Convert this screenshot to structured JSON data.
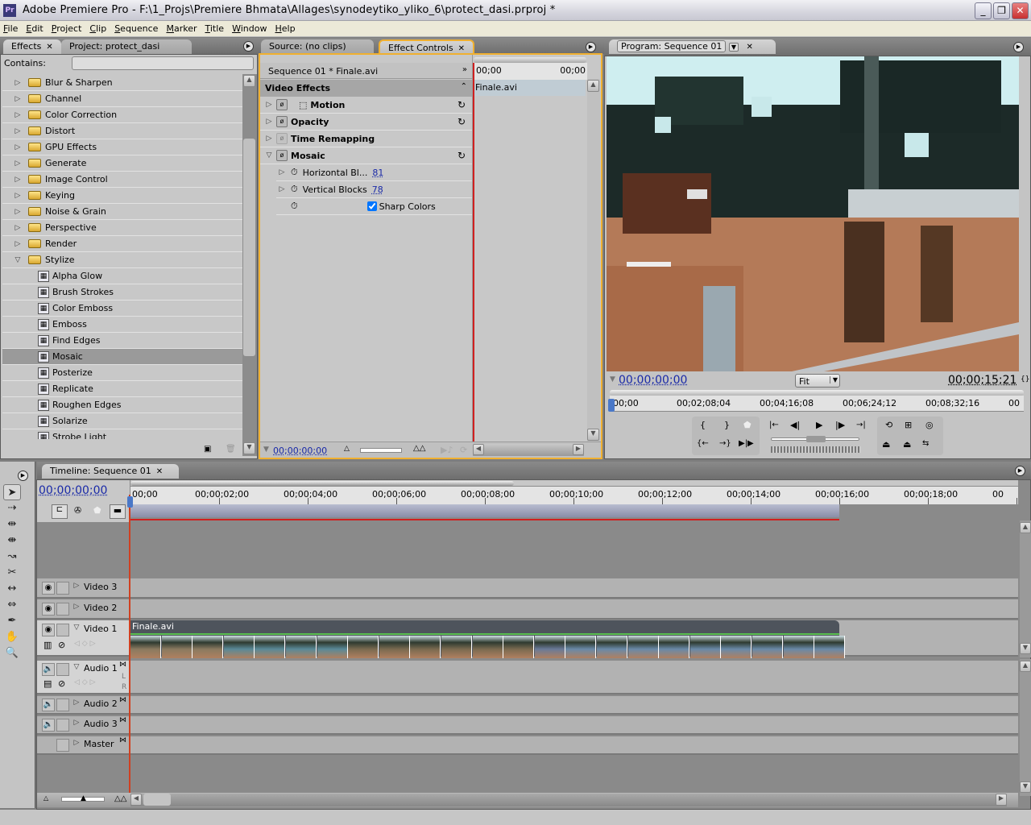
{
  "window": {
    "app_icon": "Pr",
    "title": "Adobe Premiere Pro - F:\\1_Projs\\Premiere Bhmata\\Allages\\synodeytiko_yliko_6\\protect_dasi.prproj *",
    "minimize_icon": "minimize-icon",
    "restore_icon": "restore-icon",
    "close_icon": "close-icon"
  },
  "menu": [
    {
      "label": "File",
      "key": "F"
    },
    {
      "label": "Edit",
      "key": "E"
    },
    {
      "label": "Project",
      "key": "P"
    },
    {
      "label": "Clip",
      "key": "C"
    },
    {
      "label": "Sequence",
      "key": "S"
    },
    {
      "label": "Marker",
      "key": "M"
    },
    {
      "label": "Title",
      "key": "T"
    },
    {
      "label": "Window",
      "key": "W"
    },
    {
      "label": "Help",
      "key": "H"
    }
  ],
  "effects_panel": {
    "tabs": [
      {
        "label": "Effects",
        "active": true,
        "closable": true
      },
      {
        "label": "Project: protect_dasi",
        "active": false,
        "closable": false
      }
    ],
    "contains_label": "Contains:",
    "contains_value": "",
    "folders": [
      {
        "label": "Blur & Sharpen",
        "expanded": false
      },
      {
        "label": "Channel",
        "expanded": false
      },
      {
        "label": "Color Correction",
        "expanded": false
      },
      {
        "label": "Distort",
        "expanded": false
      },
      {
        "label": "GPU Effects",
        "expanded": false
      },
      {
        "label": "Generate",
        "expanded": false
      },
      {
        "label": "Image Control",
        "expanded": false
      },
      {
        "label": "Keying",
        "expanded": false
      },
      {
        "label": "Noise & Grain",
        "expanded": false
      },
      {
        "label": "Perspective",
        "expanded": false
      },
      {
        "label": "Render",
        "expanded": false
      },
      {
        "label": "Stylize",
        "expanded": true
      }
    ],
    "stylize_effects": [
      {
        "label": "Alpha Glow",
        "selected": false
      },
      {
        "label": "Brush Strokes",
        "selected": false
      },
      {
        "label": "Color Emboss",
        "selected": false
      },
      {
        "label": "Emboss",
        "selected": false
      },
      {
        "label": "Find Edges",
        "selected": false
      },
      {
        "label": "Mosaic",
        "selected": true
      },
      {
        "label": "Posterize",
        "selected": false
      },
      {
        "label": "Replicate",
        "selected": false
      },
      {
        "label": "Roughen Edges",
        "selected": false
      },
      {
        "label": "Solarize",
        "selected": false
      },
      {
        "label": "Strobe Light",
        "selected": false
      }
    ]
  },
  "effect_controls": {
    "tabs": [
      {
        "label": "Source: (no clips)",
        "active": false
      },
      {
        "label": "Effect Controls",
        "active": true,
        "closable": true
      }
    ],
    "clip_header": "Sequence 01 * Finale.avi",
    "ruler_start": "00;00",
    "ruler_end": "00;00",
    "clip_name": "Finale.avi",
    "section_label": "Video Effects",
    "effects": [
      {
        "label": "Motion",
        "enabled": true,
        "resettable": true
      },
      {
        "label": "Opacity",
        "enabled": true,
        "resettable": true
      },
      {
        "label": "Time Remapping",
        "enabled": false,
        "resettable": false
      },
      {
        "label": "Mosaic",
        "enabled": true,
        "resettable": true,
        "expanded": true
      }
    ],
    "mosaic_params": [
      {
        "label": "Horizontal Bl...",
        "value": "81"
      },
      {
        "label": "Vertical Blocks",
        "value": "78"
      }
    ],
    "sharp_colors_label": "Sharp Colors",
    "sharp_colors_checked": true,
    "timecode": "00;00;00;00"
  },
  "program_monitor": {
    "tab_label": "Program: Sequence 01",
    "current_time": "00;00;00;00",
    "zoom_option": "Fit",
    "duration": "00;00;15;21",
    "ruler_labels": [
      "00;00",
      "00;02;08;04",
      "00;04;16;08",
      "00;06;24;12",
      "00;08;32;16",
      "00"
    ]
  },
  "timeline": {
    "tab_label": "Timeline: Sequence 01",
    "current_time": "00;00;00;00",
    "ruler_labels": [
      "00;00",
      "00;00;02;00",
      "00;00;04;00",
      "00;00;06;00",
      "00;00;08;00",
      "00;00;10;00",
      "00;00;12;00",
      "00;00;14;00",
      "00;00;16;00",
      "00;00;18;00",
      "00"
    ],
    "video_tracks": [
      {
        "label": "Video 3",
        "expanded": false
      },
      {
        "label": "Video 2",
        "expanded": false
      },
      {
        "label": "Video 1",
        "expanded": true
      }
    ],
    "audio_tracks": [
      {
        "label": "Audio 1",
        "expanded": true
      },
      {
        "label": "Audio 2",
        "expanded": false
      },
      {
        "label": "Audio 3",
        "expanded": false
      },
      {
        "label": "Master",
        "expanded": false
      }
    ],
    "audio_lr": [
      "L",
      "R"
    ],
    "clip": {
      "name": "Finale.avi",
      "track": "Video 1",
      "start": "00;00;00;00",
      "end": "00;00;15;21"
    }
  },
  "tools": [
    "selection-tool",
    "track-select-tool",
    "ripple-edit-tool",
    "rolling-edit-tool",
    "rate-stretch-tool",
    "razor-tool",
    "slip-tool",
    "slide-tool",
    "pen-tool",
    "hand-tool",
    "zoom-tool"
  ],
  "colors": {
    "panel_bg": "#c8c8c8",
    "active_border": "#f0b030",
    "timecode_blue": "#1a2aa8",
    "playhead_red": "#d02020",
    "clip_green": "#5ac050"
  }
}
